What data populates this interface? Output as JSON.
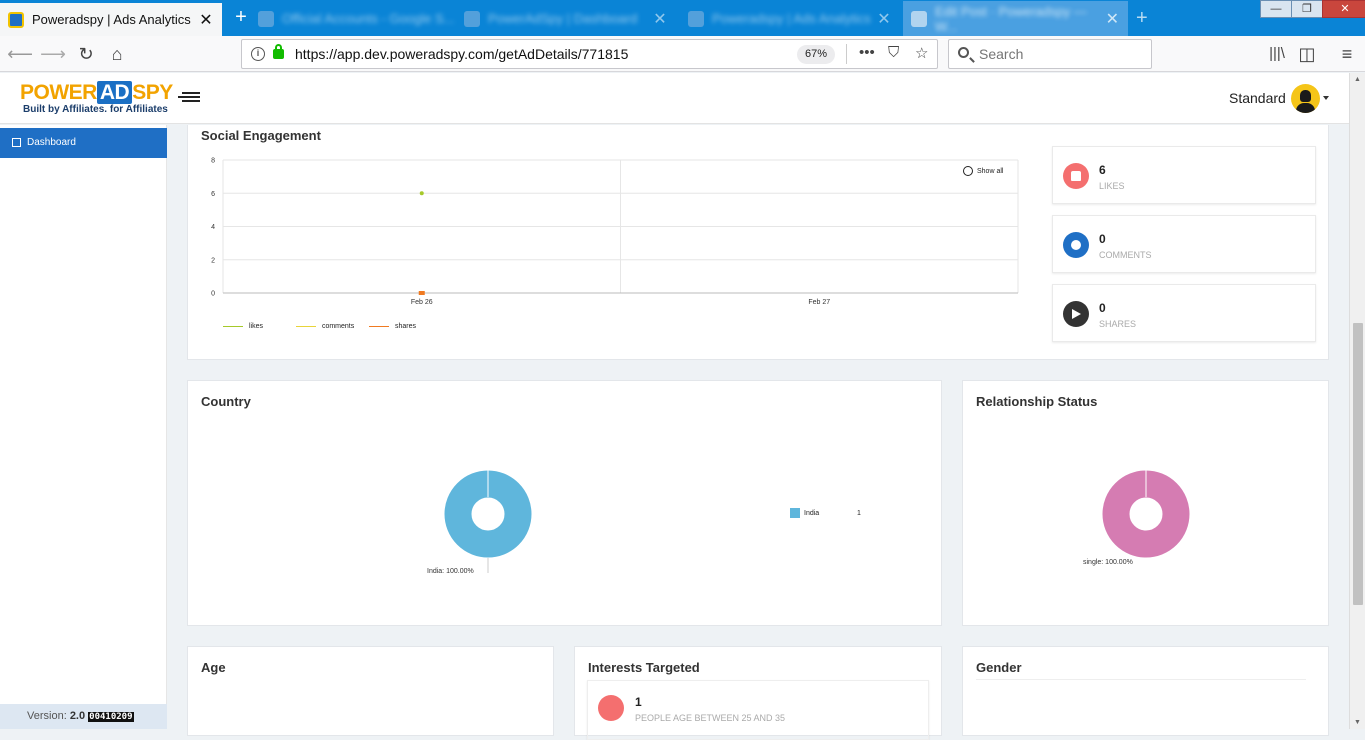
{
  "browser": {
    "tabs": [
      {
        "title": "Poweradspy | Ads Analytics",
        "close": "✕"
      },
      {
        "title": "Official Accounts - Google S..."
      },
      {
        "title": "PowerAdSpy | Dashboard"
      },
      {
        "title": "Poweradspy | Ads Analytics"
      },
      {
        "title": "Edit Post · Poweradspy — W..."
      }
    ],
    "url": "https://app.dev.poweradspy.com/getAdDetails/771815",
    "zoom": "67%",
    "search_placeholder": "Search",
    "window_controls": {
      "minimize": "—",
      "maximize": "❐",
      "close": "✕"
    }
  },
  "header": {
    "brand_part1": "POWER",
    "brand_part2": "AD",
    "brand_part3": "SPY",
    "tagline": "Built by Affiliates. for Affiliates",
    "plan": "Standard"
  },
  "sidebar": {
    "items": [
      {
        "label": "Dashboard"
      }
    ],
    "version_label": "Version:",
    "version_number": "2.0",
    "build": "00410209"
  },
  "social": {
    "title": "Social Engagement",
    "show_all": "Show all",
    "stats": [
      {
        "value": "6",
        "label": "LIKES",
        "color": "#f46f6f"
      },
      {
        "value": "0",
        "label": "COMMENTS",
        "color": "#1f6fc5"
      },
      {
        "value": "0",
        "label": "SHARES",
        "color": "#333333"
      }
    ]
  },
  "country": {
    "title": "Country",
    "slice_label": "India: 100.00%",
    "legend_name": "India",
    "legend_value": "1",
    "color": "#5fb6dc"
  },
  "relationship": {
    "title": "Relationship Status",
    "slice_label": "single: 100.00%",
    "color": "#d57cb2"
  },
  "age": {
    "title": "Age"
  },
  "interests": {
    "title": "Interests Targeted",
    "value": "1",
    "label": "PEOPLE AGE BETWEEN 25 AND 35"
  },
  "gender": {
    "title": "Gender"
  },
  "chart_data": [
    {
      "type": "line",
      "title": "Social Engagement",
      "x": [
        "Feb 26",
        "Feb 27"
      ],
      "yticks": [
        "0",
        "2",
        "4",
        "6",
        "8"
      ],
      "ylim": [
        0,
        8
      ],
      "grid": true,
      "legend_position": "bottom-left",
      "series": [
        {
          "name": "likes",
          "color": "#a6c92a",
          "points": [
            {
              "x": "Feb 26 12:00",
              "y": 6
            }
          ]
        },
        {
          "name": "comments",
          "color": "#e8d43a",
          "points": [
            {
              "x": "Feb 26 12:00",
              "y": 0
            }
          ]
        },
        {
          "name": "shares",
          "color": "#f07a21",
          "points": [
            {
              "x": "Feb 26 12:00",
              "y": 0
            }
          ]
        }
      ]
    },
    {
      "type": "pie",
      "title": "Country",
      "categories": [
        "India"
      ],
      "values": [
        1
      ],
      "percent": [
        100.0
      ]
    },
    {
      "type": "pie",
      "title": "Relationship Status",
      "categories": [
        "single"
      ],
      "values": [
        1
      ],
      "percent": [
        100.0
      ]
    }
  ]
}
